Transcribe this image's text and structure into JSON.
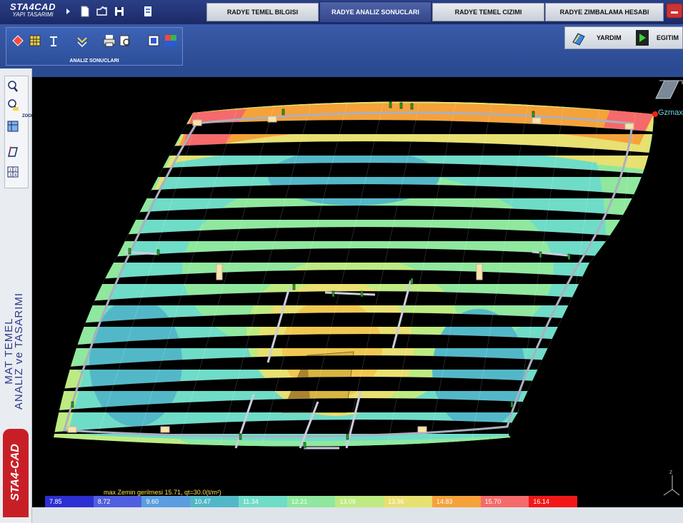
{
  "brand": {
    "title": "STA4CAD",
    "subtitle": "YAPI TASARIMI"
  },
  "toolbar": {
    "icons": [
      "new-file-icon",
      "open-folder-icon",
      "save-icon",
      "document-icon"
    ]
  },
  "tabs": [
    {
      "label": "RADYE TEMEL BILGISI",
      "active": false
    },
    {
      "label": "RADYE ANALIZ SONUCLARI",
      "active": true
    },
    {
      "label": "RADYE TEMEL CIZIMI",
      "active": false
    },
    {
      "label": "RADYE ZIMBALAMA HESABI",
      "active": false
    }
  ],
  "ribbon": {
    "label": "ANALIZ SONUCLARI",
    "icons": [
      "diamond-icon",
      "grid-icon",
      "column-icon",
      "rotate-icon",
      "print-icon",
      "preview-icon",
      "image-icon",
      "save-image-icon"
    ]
  },
  "help": {
    "yardim": "YARDIM",
    "egitim": "EGITIM"
  },
  "zoom": {
    "label": "ZOOM",
    "icons": [
      "zoom-all-icon",
      "zoom-window-icon",
      "zoom-fit-icon",
      "pan-icon",
      "layout-icon"
    ]
  },
  "side": {
    "title_line1": "MAT TEMEL",
    "title_line2": "ANALIZ ve TASARIMI",
    "brand": "STA4-CAD"
  },
  "viewport": {
    "gzmax": "Gzmax",
    "legend_title": "max Zemin gerilmesi  15.71,   qt=30.0(t/m²)",
    "legend": [
      {
        "value": "7.85",
        "color": "#2d2fd2"
      },
      {
        "value": "8.72",
        "color": "#4f5fe0"
      },
      {
        "value": "9.60",
        "color": "#5a9de0"
      },
      {
        "value": "10.47",
        "color": "#52b8c8"
      },
      {
        "value": "11.34",
        "color": "#6fdcc8"
      },
      {
        "value": "12.21",
        "color": "#8fe89e"
      },
      {
        "value": "13.09",
        "color": "#bdeb82"
      },
      {
        "value": "13.96",
        "color": "#e8e070"
      },
      {
        "value": "14.83",
        "color": "#f5a23a"
      },
      {
        "value": "15.70",
        "color": "#f56a6a"
      },
      {
        "value": "16.14",
        "color": "#f21818"
      }
    ],
    "axis_z": "Z"
  }
}
